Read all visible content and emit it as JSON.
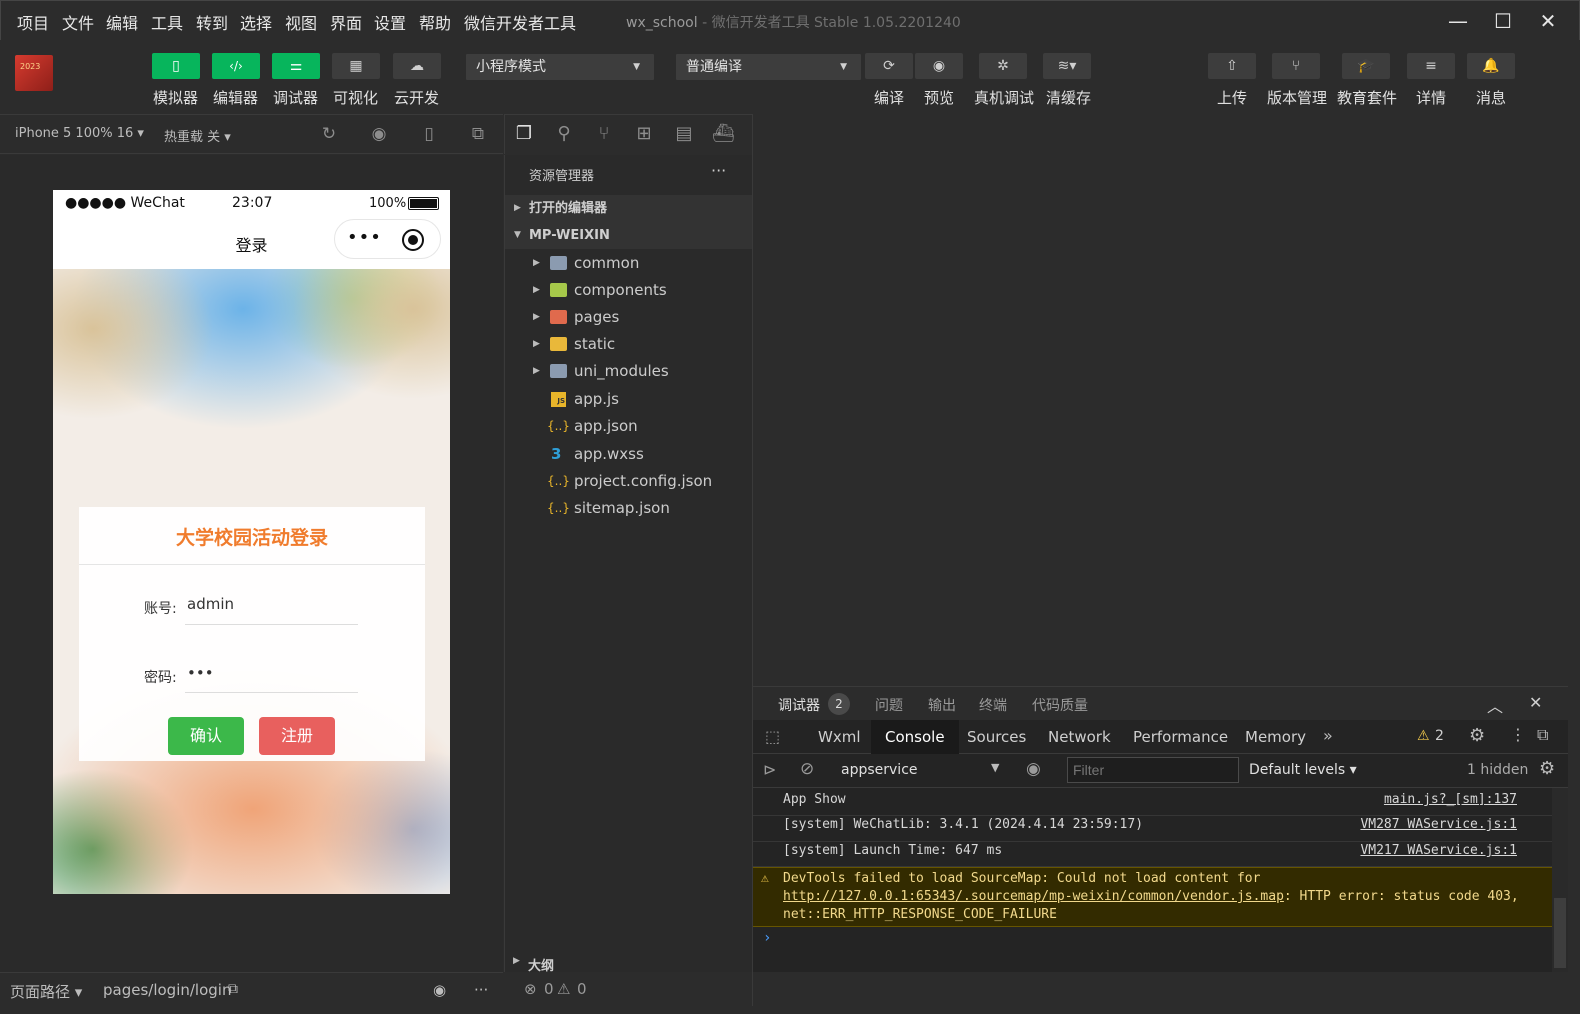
{
  "menubar": {
    "items": [
      "项目",
      "文件",
      "编辑",
      "工具",
      "转到",
      "选择",
      "视图",
      "界面",
      "设置",
      "帮助",
      "微信开发者工具"
    ],
    "window_title": "wx_school",
    "window_subtitle": "- 微信开发者工具 Stable 1.05.2201240"
  },
  "toolbar": {
    "logo_text": "2023",
    "left_buttons": [
      "模拟器",
      "编辑器",
      "调试器",
      "可视化",
      "云开发"
    ],
    "mode_select": "小程序模式",
    "compile_select": "普通编译",
    "mid_buttons": [
      "编译",
      "预览",
      "真机调试",
      "清缓存"
    ],
    "right_buttons": [
      "上传",
      "版本管理",
      "教育套件",
      "详情",
      "消息"
    ]
  },
  "simbar": {
    "device": "iPhone 5 100% 16",
    "hotreload": "热重载 关"
  },
  "phone": {
    "signal": "●●●●● WeChat",
    "time": "23:07",
    "battery": "100%",
    "nav_title": "登录",
    "login_title": "大学校园活动登录",
    "account_label": "账号:",
    "account_value": "admin",
    "password_label": "密码:",
    "password_value": "•••",
    "confirm_button": "确认",
    "register_button": "注册"
  },
  "simstatus": {
    "path_label": "页面路径",
    "path_value": "pages/login/login"
  },
  "explorer": {
    "header": "资源管理器",
    "open_editors": "打开的编辑器",
    "project": "MP-WEIXIN",
    "folders": [
      {
        "name": "common",
        "color": "#8b9bb0"
      },
      {
        "name": "components",
        "color": "#a6c84a"
      },
      {
        "name": "pages",
        "color": "#e06a4d"
      },
      {
        "name": "static",
        "color": "#e9b83a"
      },
      {
        "name": "uni_modules",
        "color": "#8b9bb0"
      }
    ],
    "files": [
      "app.js",
      "app.json",
      "app.wxss",
      "project.config.json",
      "sitemap.json"
    ],
    "outline": "大纲",
    "errors": "0",
    "warnings": "0"
  },
  "debugger": {
    "tabs": [
      "调试器",
      "问题",
      "输出",
      "终端",
      "代码质量"
    ],
    "badge": "2",
    "devtools_tabs": [
      "Wxml",
      "Console",
      "Sources",
      "Network",
      "Performance",
      "Memory"
    ],
    "warn_count": "2",
    "context": "appservice",
    "filter_placeholder": "Filter",
    "levels": "Default levels",
    "hidden": "1 hidden",
    "logs": [
      {
        "text": "App Show",
        "src": "main.js?_[sm]:137"
      },
      {
        "text": "[system] WeChatLib: 3.4.1 (2024.4.14 23:59:17)",
        "src": "VM287 WAService.js:1"
      },
      {
        "text": "[system] Launch Time: 647 ms",
        "src": "VM217 WAService.js:1"
      }
    ],
    "warning": {
      "prefix": "DevTools failed to load SourceMap: Could not load content for ",
      "link": "http://127.0.0.1:65343/.sourcemap/mp-weixin/common/vendor.js.map",
      "suffix": ": HTTP error: status code 403, net::ERR_HTTP_RESPONSE_CODE_FAILURE"
    }
  },
  "colors": {
    "green": "#07b55c",
    "accent_orange": "#f07c2d",
    "confirm_green": "#3cb84a",
    "register_red": "#e8605e"
  }
}
